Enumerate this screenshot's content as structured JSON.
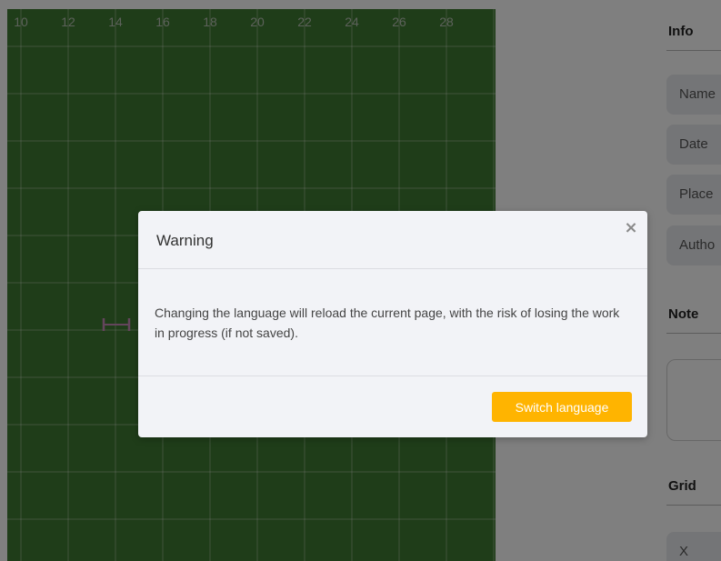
{
  "field": {
    "axis_labels": [
      "10",
      "12",
      "14",
      "16",
      "18",
      "20",
      "22",
      "24",
      "26",
      "28"
    ]
  },
  "sidebar": {
    "info_heading": "Info",
    "fields": [
      "Name",
      "Date",
      "Place",
      "Autho"
    ],
    "note_heading": "Note",
    "grid_heading": "Grid",
    "grid_fields": [
      "X"
    ]
  },
  "modal": {
    "title": "Warning",
    "close_icon": "×",
    "message": "Changing the language will reload the current page, with the risk of losing the work in progress (if not saved).",
    "confirm_label": "Switch language"
  },
  "colors": {
    "field": "#3f7a32",
    "accent": "#ffb400",
    "overlay": "rgba(0,0,0,0.5)"
  }
}
